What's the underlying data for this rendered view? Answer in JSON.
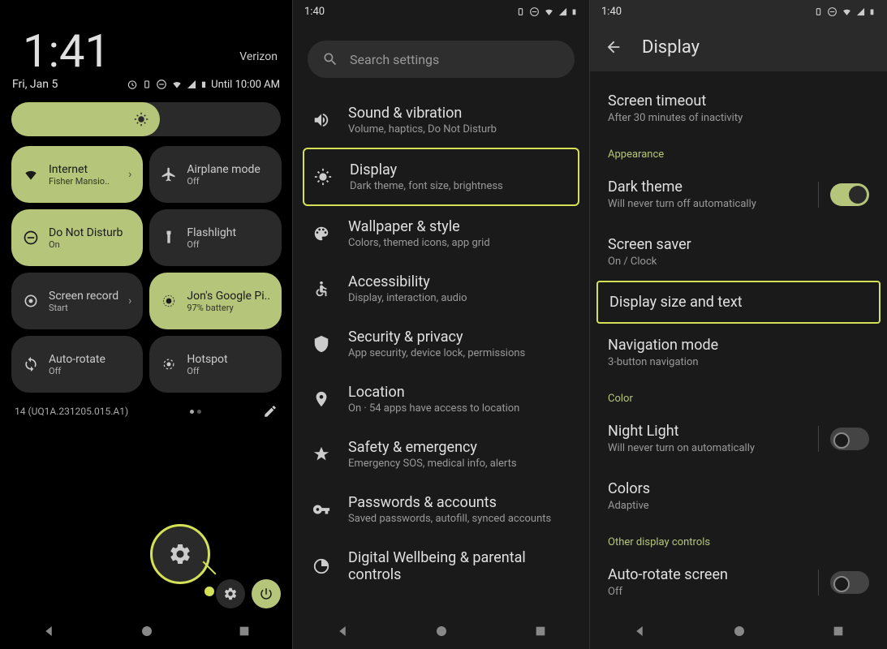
{
  "s1": {
    "time": "1:41",
    "carrier": "Verizon",
    "date": "Fri, Jan 5",
    "until": "Until 10:00 AM",
    "tiles": [
      {
        "title": "Internet",
        "sub": "Fisher Mansio..",
        "state": "on",
        "chevron": true
      },
      {
        "title": "Airplane mode",
        "sub": "Off",
        "state": "off"
      },
      {
        "title": "Do Not Disturb",
        "sub": "On",
        "state": "on"
      },
      {
        "title": "Flashlight",
        "sub": "Off",
        "state": "off"
      },
      {
        "title": "Screen record",
        "sub": "Start",
        "state": "off",
        "chevron": true
      },
      {
        "title": "Jon's Google Pi..",
        "sub": "97% battery",
        "state": "on"
      },
      {
        "title": "Auto-rotate",
        "sub": "Off",
        "state": "off"
      },
      {
        "title": "Hotspot",
        "sub": "Off",
        "state": "off"
      }
    ],
    "build": "14 (UQ1A.231205.015.A1)"
  },
  "s2": {
    "time": "1:40",
    "search_placeholder": "Search settings",
    "items": [
      {
        "title": "Sound & vibration",
        "sub": "Volume, haptics, Do Not Disturb"
      },
      {
        "title": "Display",
        "sub": "Dark theme, font size, brightness",
        "highlighted": true
      },
      {
        "title": "Wallpaper & style",
        "sub": "Colors, themed icons, app grid"
      },
      {
        "title": "Accessibility",
        "sub": "Display, interaction, audio"
      },
      {
        "title": "Security & privacy",
        "sub": "App security, device lock, permissions"
      },
      {
        "title": "Location",
        "sub": "On · 54 apps have access to location"
      },
      {
        "title": "Safety & emergency",
        "sub": "Emergency SOS, medical info, alerts"
      },
      {
        "title": "Passwords & accounts",
        "sub": "Saved passwords, autofill, synced accounts"
      },
      {
        "title": "Digital Wellbeing & parental controls",
        "sub": ""
      }
    ]
  },
  "s3": {
    "time": "1:40",
    "title": "Display",
    "screen_timeout": {
      "title": "Screen timeout",
      "sub": "After 30 minutes of inactivity"
    },
    "appearance_label": "Appearance",
    "dark_theme": {
      "title": "Dark theme",
      "sub": "Will never turn off automatically",
      "on": true
    },
    "screen_saver": {
      "title": "Screen saver",
      "sub": "On / Clock"
    },
    "display_size": {
      "title": "Display size and text",
      "highlighted": true
    },
    "nav_mode": {
      "title": "Navigation mode",
      "sub": "3-button navigation"
    },
    "color_label": "Color",
    "night_light": {
      "title": "Night Light",
      "sub": "Will never turn on automatically",
      "on": false
    },
    "colors": {
      "title": "Colors",
      "sub": "Adaptive"
    },
    "other_label": "Other display controls",
    "auto_rotate": {
      "title": "Auto-rotate screen",
      "sub": "Off",
      "on": false
    }
  }
}
